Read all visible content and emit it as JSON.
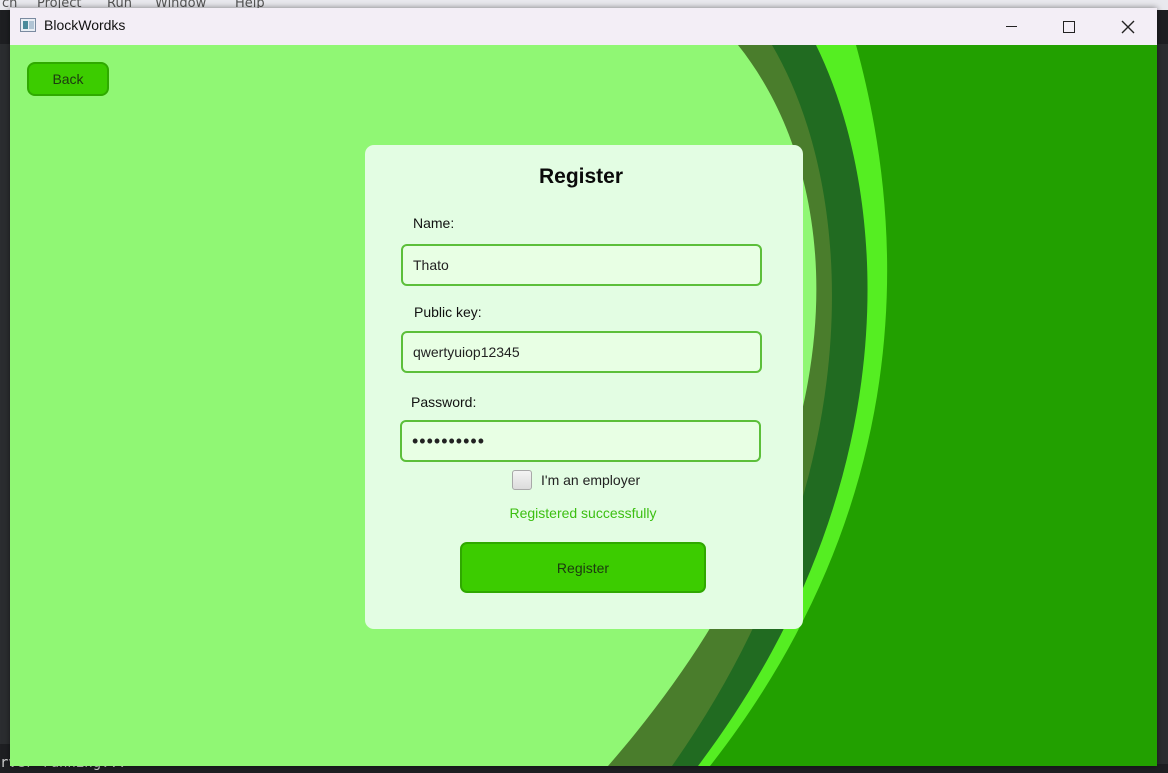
{
  "window": {
    "title": "BlockWordks"
  },
  "background": {
    "menu": [
      "ch",
      "Project",
      "Run",
      "Window",
      "Help"
    ],
    "console_text": "rver running..."
  },
  "toolbar": {
    "back_label": "Back"
  },
  "form": {
    "title": "Register",
    "name_label": "Name:",
    "name_value": "Thato",
    "public_key_label": "Public key:",
    "public_key_value": "qwertyuiop12345",
    "password_label": "Password:",
    "password_value": "••••••••••",
    "employer_checkbox_label": "I'm an employer",
    "employer_checked": false,
    "status_message": "Registered successfully",
    "register_label": "Register"
  },
  "colors": {
    "background": "#90f774",
    "accent": "#3ccc00",
    "card": "#e3fde3",
    "success_text": "#3cbf12"
  }
}
